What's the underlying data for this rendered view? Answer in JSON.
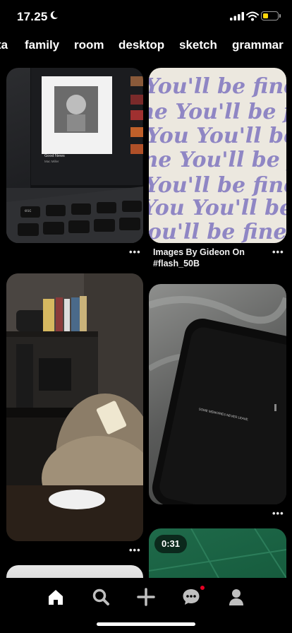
{
  "status_bar": {
    "time": "17.25",
    "icons": [
      "moon-icon",
      "signal-icon",
      "wifi-icon",
      "battery-icon"
    ],
    "battery_color": "#ffd60a"
  },
  "tabs": [
    "ta",
    "family",
    "room",
    "desktop",
    "sketch",
    "grammar"
  ],
  "pins": {
    "laptop": {
      "song_title": "Good News",
      "artist": "Mac Miller",
      "keys": [
        "esc",
        "F1",
        "F2",
        "F3",
        "F4"
      ]
    },
    "typography": {
      "caption": "Images By Gideon On #flash_50B",
      "pattern_text": "You'll be fine"
    },
    "tablet": {
      "screen_text": "SOME MEMORIES NEVER LEAVE."
    },
    "video": {
      "duration": "0:31"
    }
  },
  "nav": {
    "items": [
      "home-icon",
      "search-icon",
      "create-icon",
      "messages-icon",
      "profile-icon"
    ],
    "notification_color": "#e60023"
  }
}
